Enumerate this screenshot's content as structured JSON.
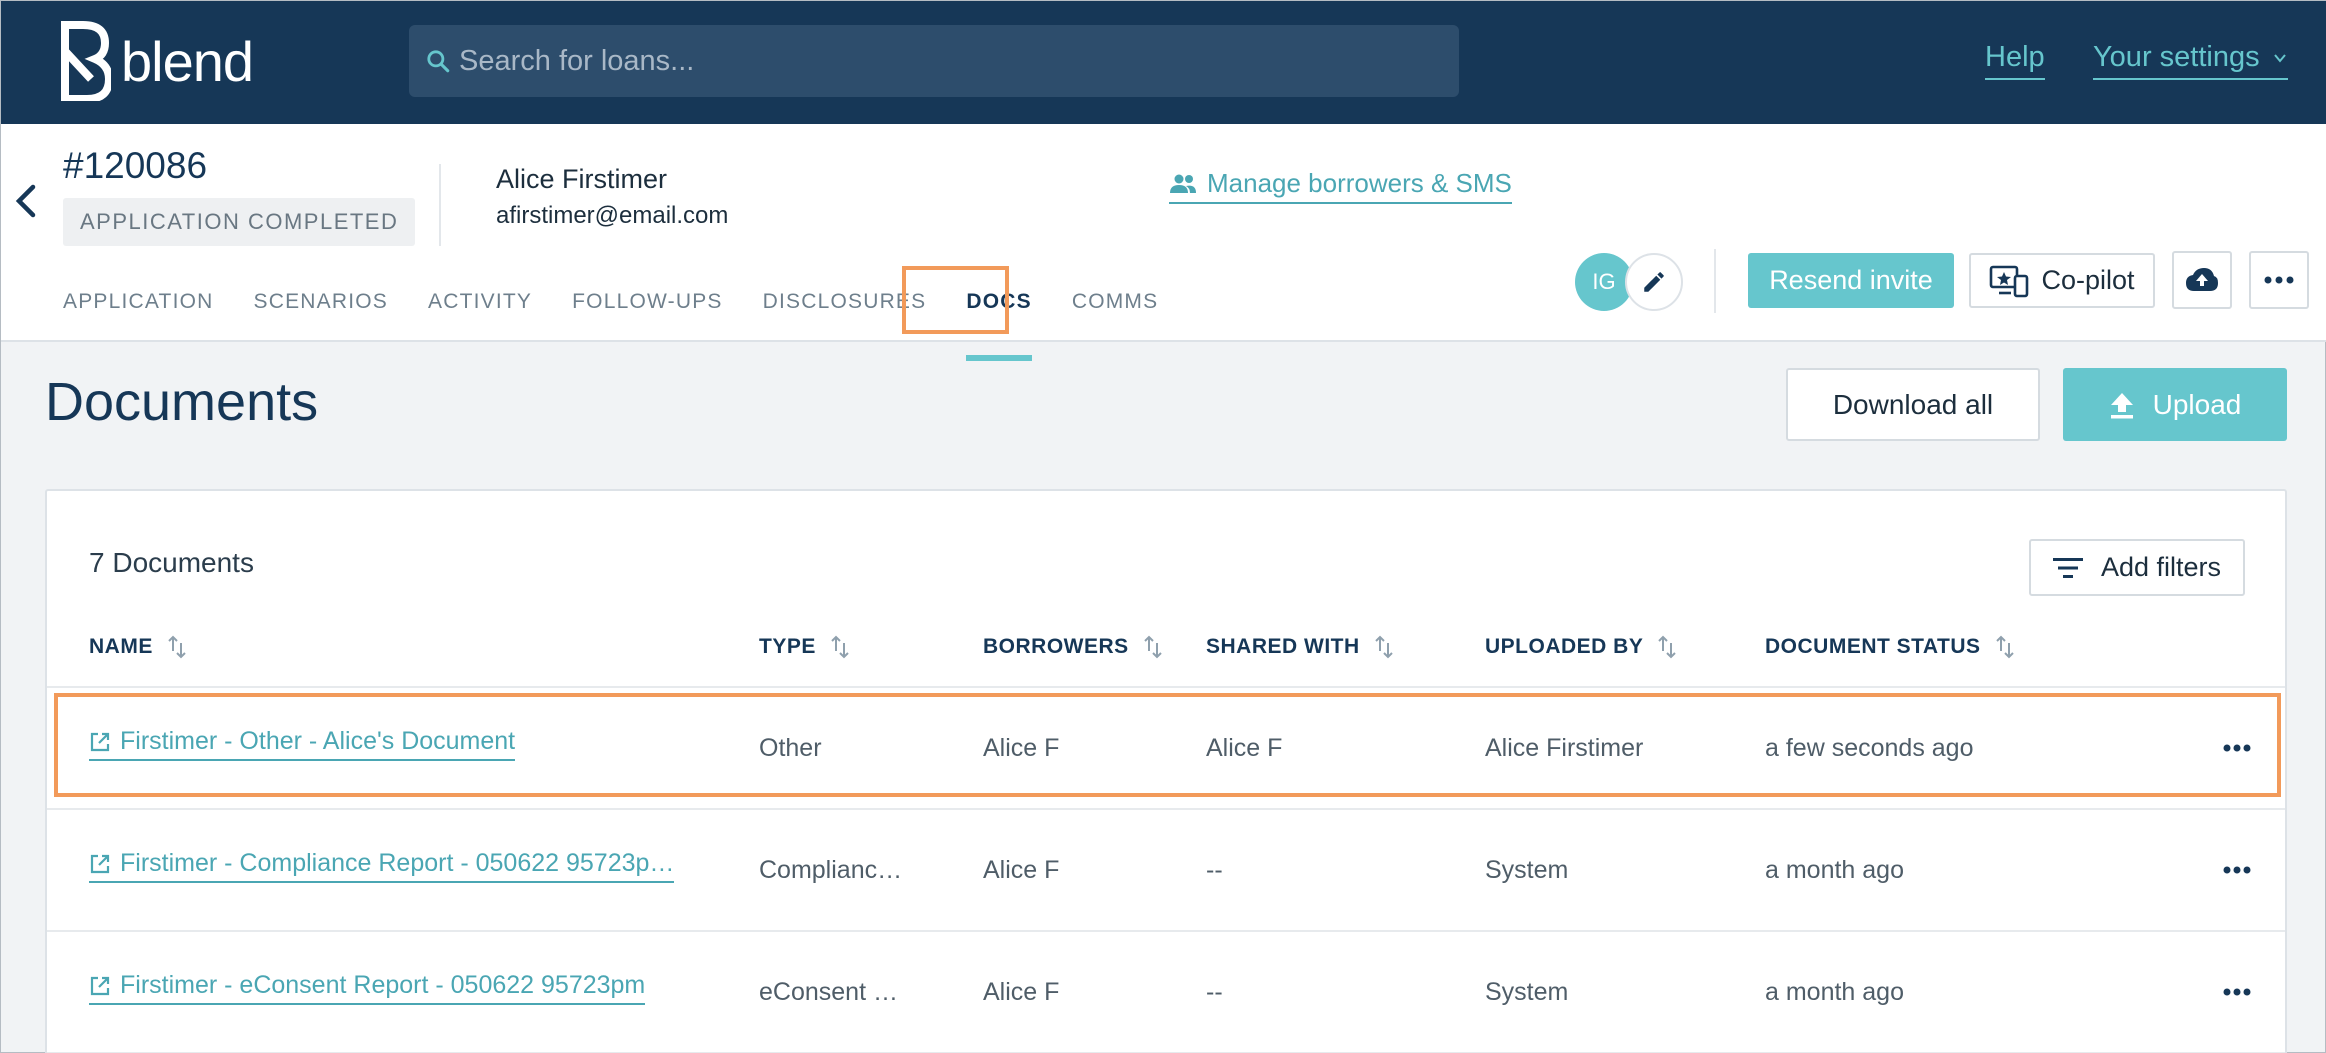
{
  "app": {
    "brand": "blend",
    "accent": "#66c6cd",
    "nav_color": "#163757",
    "highlight": "#f29a5a"
  },
  "topbar": {
    "search_placeholder": "Search for loans...",
    "help": "Help",
    "settings": "Your settings"
  },
  "loan": {
    "number": "#120086",
    "status": "APPLICATION COMPLETED",
    "borrower_name": "Alice Firstimer",
    "borrower_email": "afirstimer@email.com",
    "manage_link": "Manage borrowers & SMS"
  },
  "tabs": [
    "APPLICATION",
    "SCENARIOS",
    "ACTIVITY",
    "FOLLOW-UPS",
    "DISCLOSURES",
    "DOCS",
    "COMMS"
  ],
  "active_tab": "DOCS",
  "actions": {
    "avatar_initials": "IG",
    "resend": "Resend invite",
    "copilot": "Co-pilot"
  },
  "documents": {
    "title": "Documents",
    "download_all": "Download all",
    "upload": "Upload",
    "count_label": "7 Documents",
    "add_filters": "Add filters",
    "columns": [
      "NAME",
      "TYPE",
      "BORROWERS",
      "SHARED WITH",
      "UPLOADED BY",
      "DOCUMENT STATUS"
    ],
    "rows": [
      {
        "name": "Firstimer - Other - Alice's Document",
        "type": "Other",
        "borrowers": "Alice F",
        "shared_with": "Alice F",
        "uploaded_by": "Alice Firstimer",
        "status": "a few seconds ago"
      },
      {
        "name": "Firstimer - Compliance Report - 050622 95723p…",
        "type": "Complianc…",
        "borrowers": "Alice F",
        "shared_with": "--",
        "uploaded_by": "System",
        "status": "a month ago"
      },
      {
        "name": "Firstimer - eConsent Report - 050622 95723pm",
        "type": "eConsent …",
        "borrowers": "Alice F",
        "shared_with": "--",
        "uploaded_by": "System",
        "status": "a month ago"
      }
    ]
  }
}
